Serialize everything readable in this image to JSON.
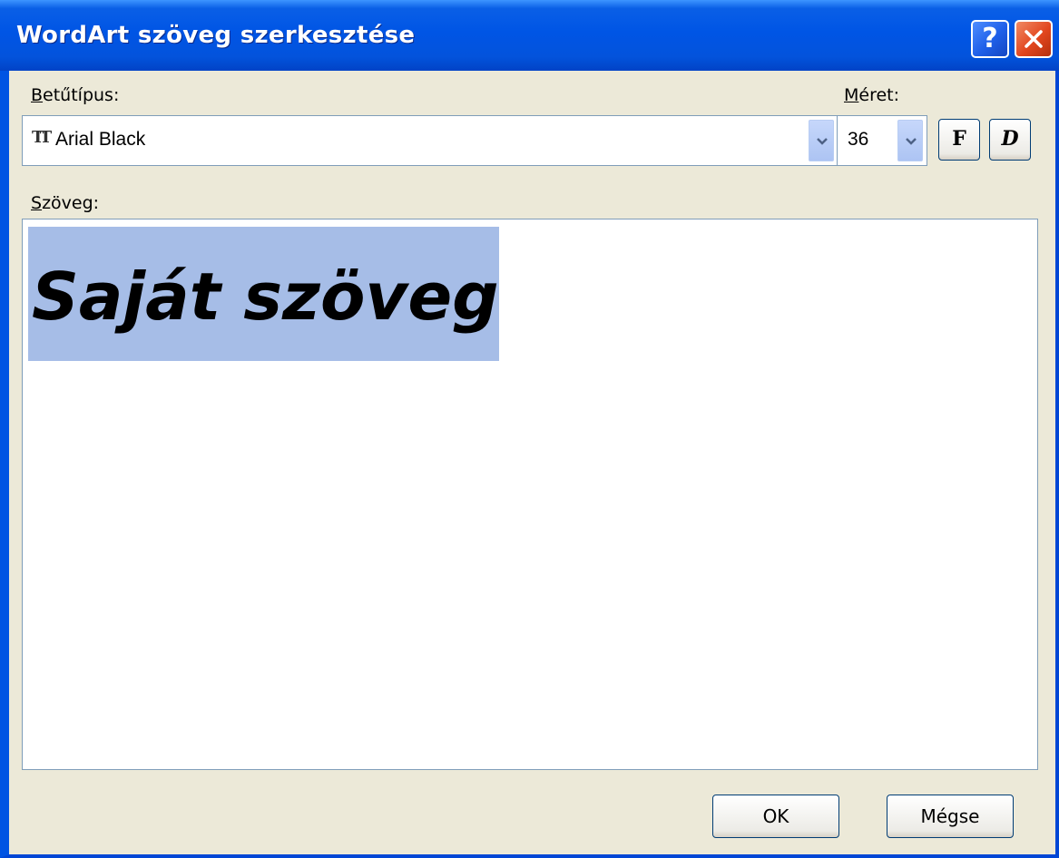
{
  "window": {
    "title": "WordArt szöveg szerkesztése",
    "help_glyph": "?",
    "titlebar_color": "#0055e5"
  },
  "font": {
    "label_accel": "B",
    "label_rest": "etűtípus:",
    "value": "Arial Black",
    "icon": "truetype-font-icon",
    "icon_glyph": "TT"
  },
  "size": {
    "label_accel": "M",
    "label_rest": "éret:",
    "value": "36"
  },
  "style_buttons": {
    "bold_label": "F",
    "italic_label": "D"
  },
  "text": {
    "label_accel": "S",
    "label_rest": "zöveg:",
    "value": "Saját szöveg",
    "selected": true,
    "selection_color": "#a6bde7"
  },
  "buttons": {
    "ok_label": "OK",
    "cancel_label": "Mégse"
  }
}
